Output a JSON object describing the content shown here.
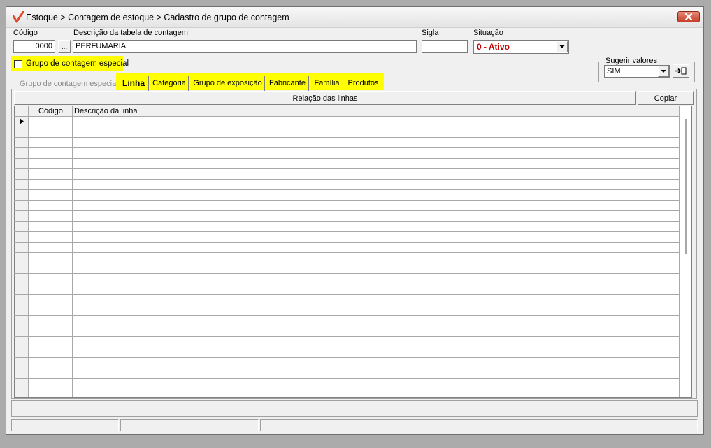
{
  "window": {
    "title": "Estoque > Contagem de estoque > Cadastro de grupo de contagem",
    "accent": "#e04a2a"
  },
  "form": {
    "codigo_label": "Código",
    "codigo_value": "0000",
    "lookup_label": "...",
    "descricao_label": "Descrição da tabela de contagem",
    "descricao_value": "PERFUMARIA",
    "sigla_label": "Sigla",
    "sigla_value": "",
    "situacao_label": "Situação",
    "situacao_value": "0 - Ativo",
    "situacao_color": "#c00000",
    "grupo_especial_label": "Grupo de contagem especial",
    "grupo_especial_checked": false
  },
  "sugerir": {
    "label": "Sugerir valores",
    "value": "SIM"
  },
  "tabs": {
    "disabled_label": "Grupo de contagem especial",
    "items": [
      "Linha",
      "Categoria",
      "Grupo de exposição",
      "Fabricante",
      "Família",
      "Produtos"
    ],
    "active": "Linha",
    "highlight_color": "#ffff00"
  },
  "panel": {
    "header": "Relação das linhas",
    "copy_label": "Copiar"
  },
  "table": {
    "columns": [
      "Código",
      "Descrição da linha"
    ],
    "rows": []
  }
}
